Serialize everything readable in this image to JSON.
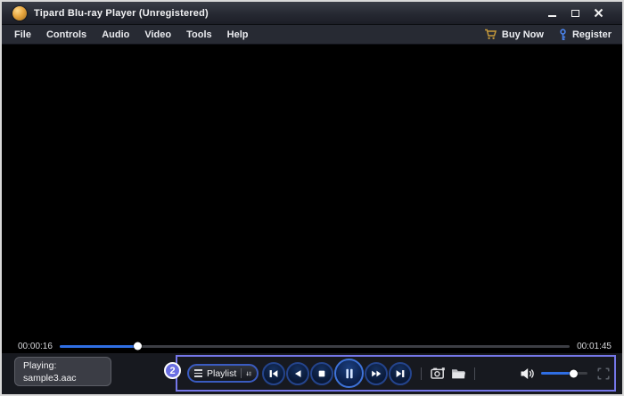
{
  "window": {
    "title": "Tipard Blu-ray Player (Unregistered)"
  },
  "menu": {
    "items": [
      "File",
      "Controls",
      "Audio",
      "Video",
      "Tools",
      "Help"
    ],
    "buy_now_label": "Buy Now",
    "register_label": "Register"
  },
  "seek": {
    "current_time": "00:00:16",
    "total_time": "00:01:45",
    "fill_style": "width:88px"
  },
  "status_box": {
    "line1": "Playing:",
    "line2": "sample3.aac"
  },
  "annotation": {
    "step_number": "2"
  },
  "playback": {
    "playlist_label": "Playlist",
    "buttons": [
      "previous",
      "rewind",
      "stop",
      "pause",
      "fast-forward",
      "next"
    ],
    "volume": {
      "fill_style": "width:37px"
    }
  },
  "colors": {
    "accent_blue": "#2f6ee4",
    "highlight_border": "#7577e9",
    "annotation_fill": "#6b6fe2",
    "buy_now_gold": "#c79a3b",
    "register_blue": "#4a82ea",
    "button_ring": "#24448c"
  }
}
